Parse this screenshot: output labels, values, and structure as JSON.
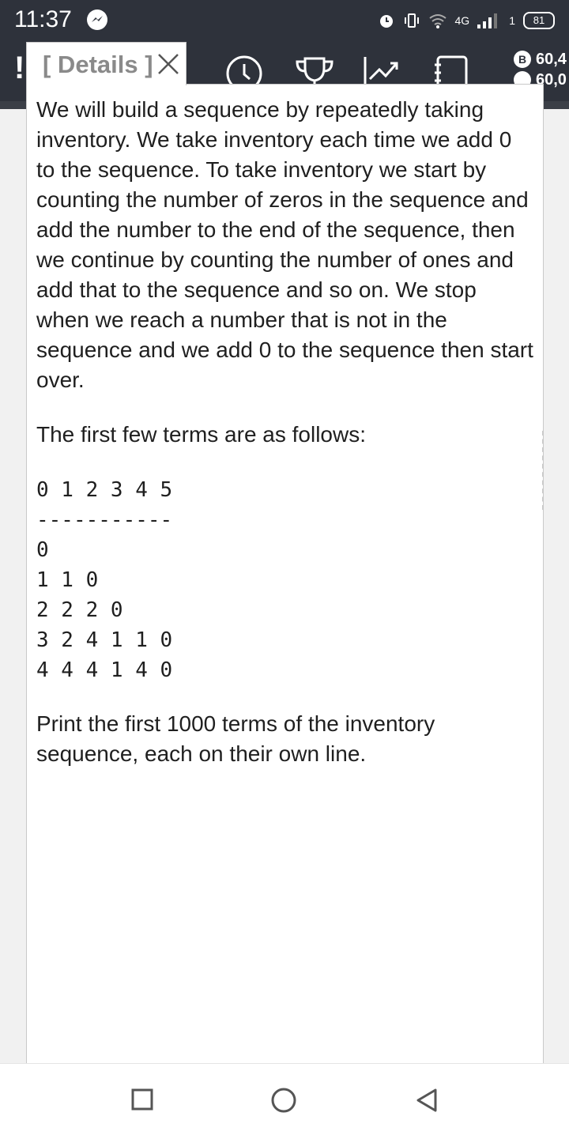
{
  "status_bar": {
    "time": "11:37",
    "network": "4G",
    "sim_slot": "1",
    "battery": "81"
  },
  "app_bar": {
    "alert_label": "!",
    "coins": [
      "60,4",
      "60,0"
    ],
    "tab_icons": [
      "clock-icon",
      "trophy-icon",
      "trending-up-icon",
      "notebook-icon"
    ]
  },
  "tab": {
    "label": "[ Details ]"
  },
  "problem": {
    "paragraph1": "We will build a sequence by repeatedly taking inventory. We take inventory each time we add 0 to the sequence. To take inventory we start by counting the number of zeros in the sequence and add the number to the end of the sequence, then we continue by counting the number of ones and add that to the sequence and so on. We stop when we reach a number that is not in the sequence and we add 0 to the sequence then start over.",
    "paragraph2": "The first few terms are as follows:",
    "table_header": "0 1 2 3 4 5",
    "table_rule": "-----------",
    "table_rows": [
      "0",
      "1 1 0",
      "2 2 2 0",
      "3 2 4 1 1 0",
      "4 4 4 1 4 0"
    ],
    "paragraph3": "Print the first 1000 terms of the inventory sequence, each on their own line."
  },
  "colors": {
    "header_bg": "#2e323b",
    "panel_bg": "#ffffff",
    "page_bg": "#f1f1f1",
    "tab_label": "#8a8a8a",
    "text": "#1f1f1f"
  }
}
